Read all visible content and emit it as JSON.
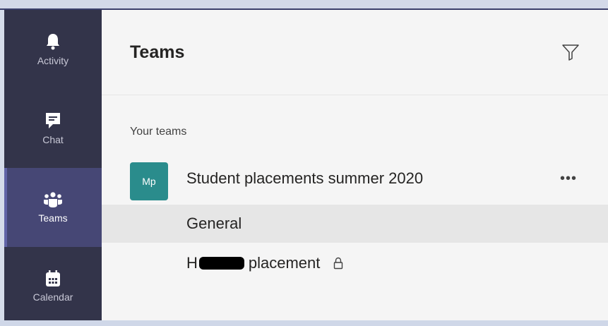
{
  "rail": {
    "items": [
      {
        "label": "Activity",
        "icon": "bell-icon"
      },
      {
        "label": "Chat",
        "icon": "chat-icon"
      },
      {
        "label": "Teams",
        "icon": "teams-icon",
        "active": true
      },
      {
        "label": "Calendar",
        "icon": "calendar-icon"
      }
    ]
  },
  "panel": {
    "title": "Teams",
    "filter_icon": "filter-icon",
    "section_label": "Your teams",
    "team": {
      "avatar_initials": "Mp",
      "avatar_color": "#2a8c8c",
      "name": "Student placements summer 2020",
      "more_label": "•••"
    },
    "channels": [
      {
        "label": "General",
        "selected": true
      },
      {
        "label_prefix": "H",
        "label_suffix": "placement",
        "private": true
      }
    ]
  },
  "colors": {
    "rail_bg": "#33344a",
    "rail_active": "#464775",
    "accent": "#6264a7"
  }
}
